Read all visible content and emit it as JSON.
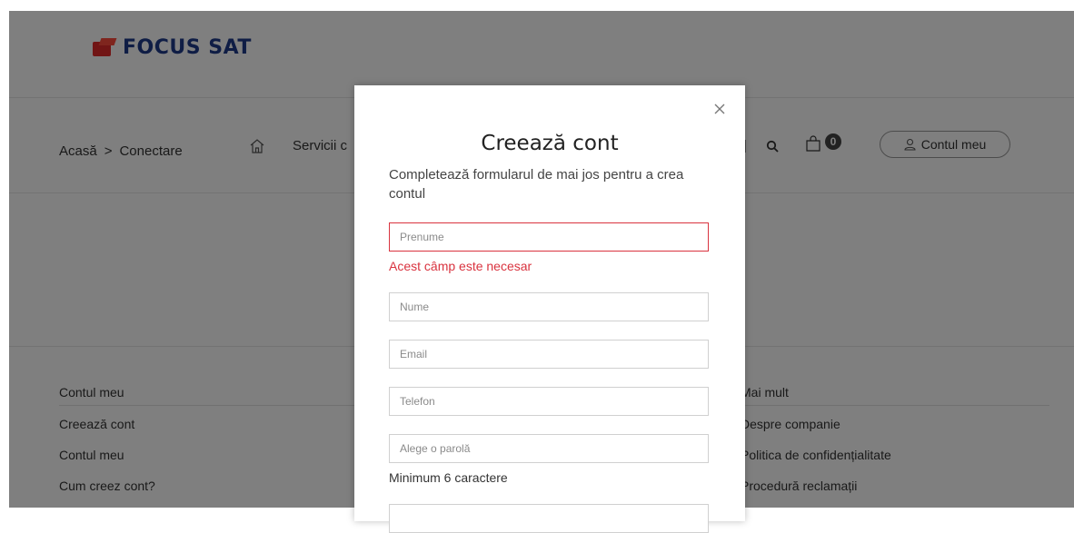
{
  "brand": {
    "name": "FOCUS SAT"
  },
  "breadcrumb": {
    "home": "Acasă",
    "separator": ">",
    "current": "Conectare"
  },
  "nav": {
    "services_label": "Servicii c",
    "partial_trailing": "|"
  },
  "cart": {
    "count": "0"
  },
  "account": {
    "label": "Contul meu"
  },
  "footer": {
    "left_links": [
      "Contul meu",
      "Creează cont",
      "Contul meu",
      "Cum creez cont?"
    ],
    "right_links": [
      "Mai mult",
      "Despre companie",
      "Politica de confidențialitate",
      "Procedură reclamații"
    ]
  },
  "modal": {
    "close_symbol": "×",
    "title": "Creează cont",
    "subtitle": "Completează formularul de mai jos pentru a crea contul",
    "fields": {
      "first_name_placeholder": "Prenume",
      "last_name_placeholder": "Nume",
      "email_placeholder": "Email",
      "phone_placeholder": "Telefon",
      "password_placeholder": "Alege o parolă"
    },
    "first_name_error": "Acest câmp este necesar",
    "password_hint": "Minimum 6 caractere"
  },
  "colors": {
    "error": "#d9333f",
    "brand_red": "#e32b2b",
    "brand_blue": "#1e3a8a",
    "overlay": "rgba(0,0,0,0.5)"
  },
  "icons": [
    "home-icon",
    "search-icon",
    "shopping-bag-icon",
    "user-icon",
    "close-icon"
  ]
}
